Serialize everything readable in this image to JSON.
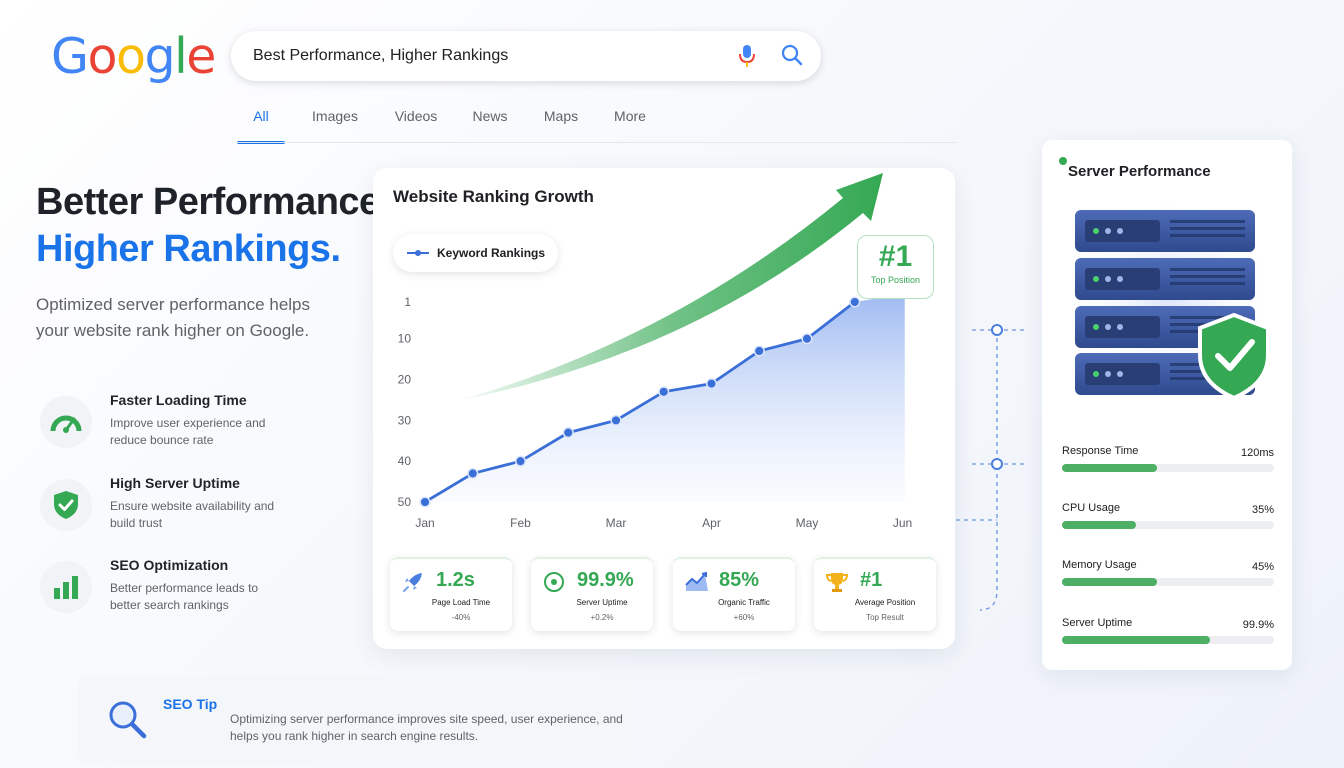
{
  "logo": {
    "letters": [
      "G",
      "o",
      "o",
      "g",
      "l",
      "e"
    ],
    "colors": [
      "#4285f4",
      "#ea4335",
      "#fbbc05",
      "#4285f4",
      "#34a853",
      "#ea4335"
    ]
  },
  "search": {
    "value": "Best Performance, Higher Rankings",
    "mic_icon": "microphone-icon",
    "search_icon": "search-icon"
  },
  "tabs": [
    {
      "label": "All",
      "active": true
    },
    {
      "label": "Images"
    },
    {
      "label": "Videos"
    },
    {
      "label": "News"
    },
    {
      "label": "Maps"
    },
    {
      "label": "More"
    }
  ],
  "hero": {
    "line1": "Better Performance.",
    "line2": "Higher Rankings.",
    "lead": "Optimized server performance helps your website rank higher on Google."
  },
  "features": [
    {
      "title": "Faster Loading Time",
      "desc": "Improve user experience and reduce bounce rate",
      "icon": "speedometer-icon"
    },
    {
      "title": "High Server Uptime",
      "desc": "Ensure website availability and build trust",
      "icon": "shield-check-icon"
    },
    {
      "title": "SEO Optimization",
      "desc": "Better performance leads to better search rankings",
      "icon": "bar-chart-icon"
    }
  ],
  "chart_card": {
    "title": "Website Ranking Growth",
    "legend": "Keyword Rankings",
    "badge_value": "#1",
    "badge_label": "Top Position"
  },
  "chart_data": {
    "type": "line",
    "title": "Website Ranking Growth",
    "x": [
      "Jan",
      "Feb",
      "Mar",
      "Apr",
      "May",
      "Jun"
    ],
    "yticks": [
      1,
      10,
      20,
      30,
      40,
      50
    ],
    "ylim": [
      50,
      1
    ],
    "y_inverted": true,
    "series": [
      {
        "name": "Keyword Rankings",
        "color": "#3b6fd8",
        "points": [
          [
            0,
            50
          ],
          [
            0.5,
            43
          ],
          [
            1,
            40
          ],
          [
            1.5,
            33
          ],
          [
            2,
            30
          ],
          [
            2.5,
            23
          ],
          [
            3,
            21
          ],
          [
            3.5,
            13
          ],
          [
            4,
            10
          ],
          [
            4.5,
            1
          ]
        ]
      }
    ]
  },
  "stats": [
    {
      "value": "1.2s",
      "label": "Page Load Time",
      "change": "-40%",
      "icon": "rocket-icon"
    },
    {
      "value": "99.9%",
      "label": "Server Uptime",
      "change": "+0.2%",
      "icon": "target-icon"
    },
    {
      "value": "85%",
      "label": "Organic Traffic",
      "change": "+60%",
      "icon": "trend-chart-icon"
    },
    {
      "value": "#1",
      "label": "Average Position",
      "change": "Top Result",
      "icon": "trophy-icon"
    }
  ],
  "server": {
    "title": "Server Performance",
    "metrics": [
      {
        "label": "Response Time",
        "value": "120ms",
        "fill": 0.45
      },
      {
        "label": "CPU Usage",
        "value": "35%",
        "fill": 0.35
      },
      {
        "label": "Memory Usage",
        "value": "45%",
        "fill": 0.45
      },
      {
        "label": "Server Uptime",
        "value": "99.9%",
        "fill": 0.7
      }
    ]
  },
  "tip": {
    "title": "SEO Tip",
    "text": "Optimizing server performance improves site speed, user experience, and helps you rank higher in search engine results."
  }
}
